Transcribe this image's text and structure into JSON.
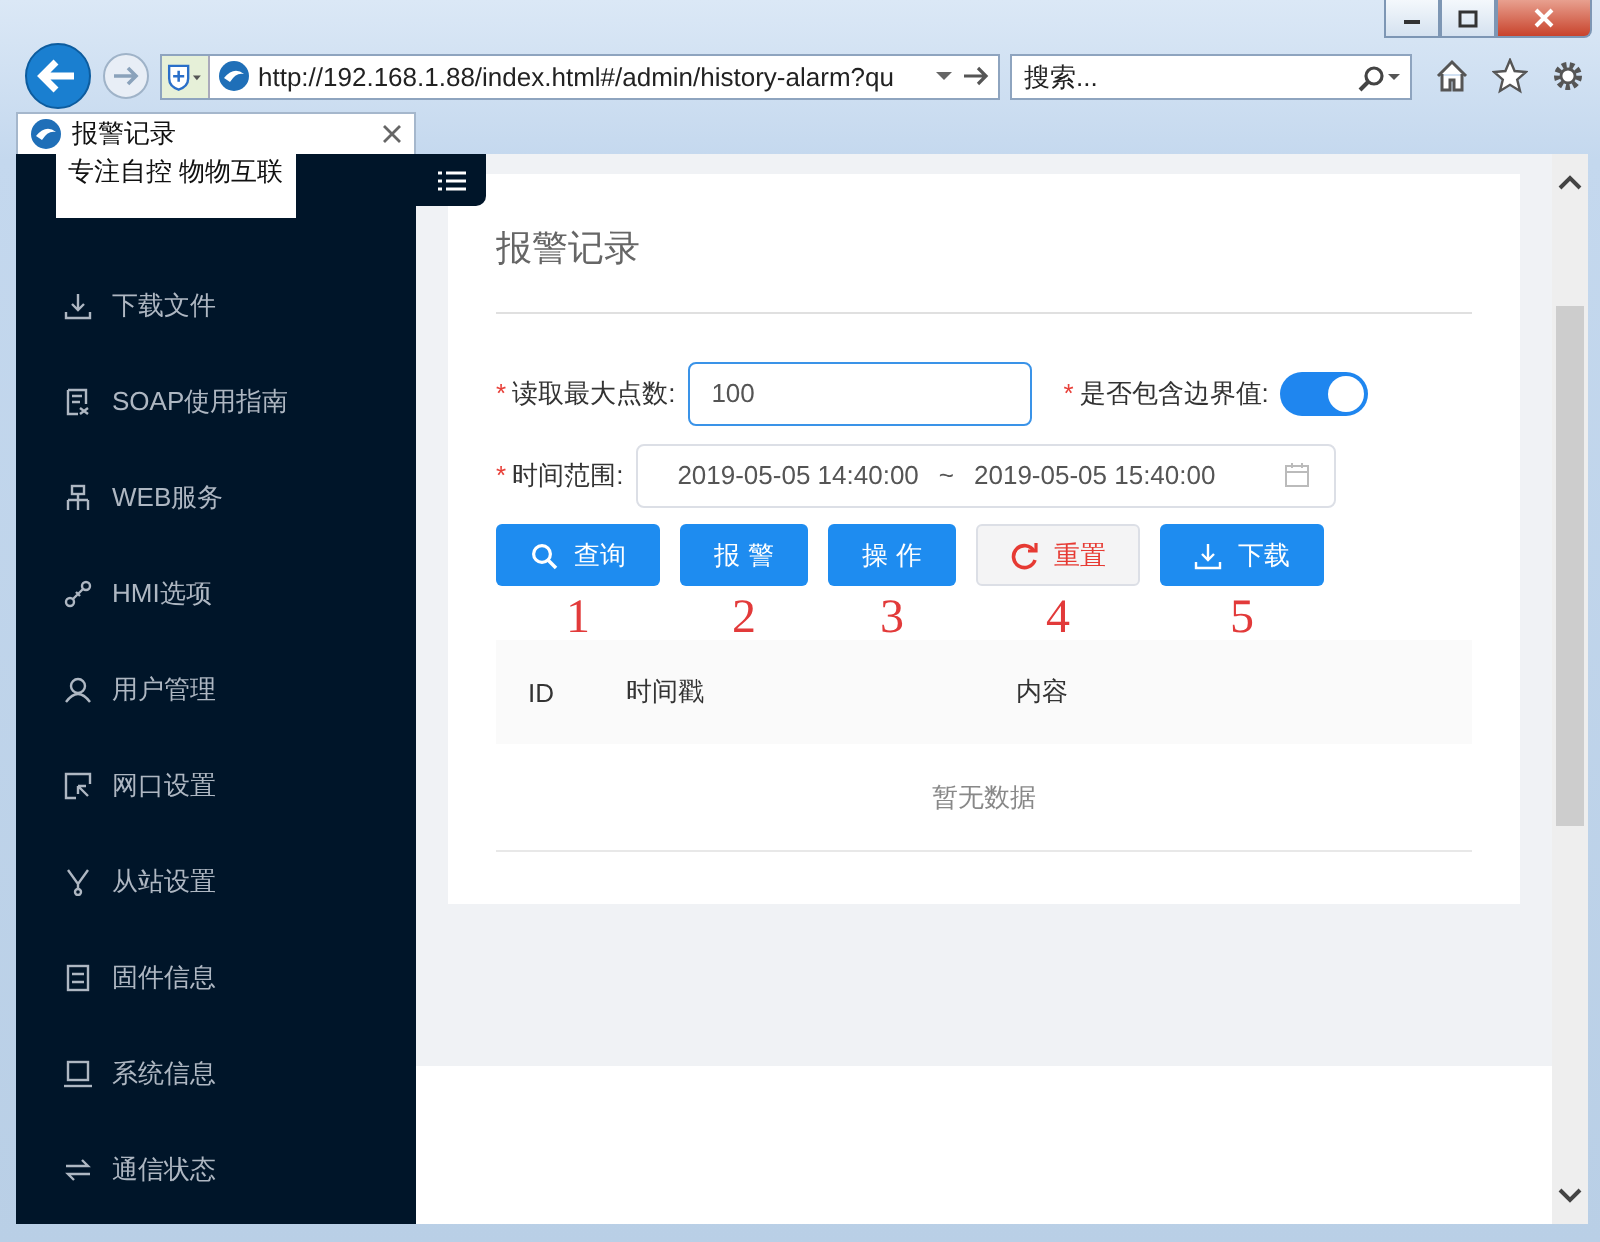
{
  "browser": {
    "address": "http://192.168.1.88/index.html#/admin/history-alarm?qu",
    "search": {
      "placeholder": "搜索..."
    },
    "tab": {
      "title": "报警记录"
    }
  },
  "sidebar": {
    "logo_text": "专注自控 物物互联",
    "items": [
      {
        "label": "下载文件"
      },
      {
        "label": "SOAP使用指南"
      },
      {
        "label": "WEB服务"
      },
      {
        "label": "HMI选项"
      },
      {
        "label": "用户管理"
      },
      {
        "label": "网口设置"
      },
      {
        "label": "从站设置"
      },
      {
        "label": "固件信息"
      },
      {
        "label": "系统信息"
      },
      {
        "label": "通信状态"
      }
    ]
  },
  "page": {
    "title": "报警记录",
    "form": {
      "max_points": {
        "required_mark": "*",
        "label": "读取最大点数:",
        "value": "100"
      },
      "include_bounds": {
        "required_mark": "*",
        "label": "是否包含边界值:",
        "on": true
      },
      "time_range": {
        "required_mark": "*",
        "label": "时间范围:",
        "start": "2019-05-05 14:40:00",
        "separator": "~",
        "end": "2019-05-05 15:40:00"
      }
    },
    "buttons": [
      {
        "label": "查询",
        "kind": "primary"
      },
      {
        "label": "报 警",
        "kind": "primary"
      },
      {
        "label": "操 作",
        "kind": "primary"
      },
      {
        "label": "重置",
        "kind": "default"
      },
      {
        "label": "下载",
        "kind": "primary"
      }
    ],
    "annotations": [
      "1",
      "2",
      "3",
      "4",
      "5"
    ],
    "table": {
      "columns": [
        "ID",
        "时间戳",
        "内容"
      ],
      "empty_text": "暂无数据"
    }
  }
}
